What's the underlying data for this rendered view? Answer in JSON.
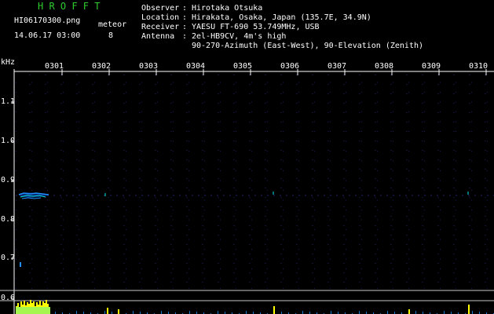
{
  "header": {
    "brand": "H R O F F T",
    "filename": "HI06170300.png",
    "datetime": "14.06.17 03:00",
    "meteor_label": "meteor",
    "meteor_count": "8"
  },
  "meta": [
    {
      "key": "Observer",
      "value": "Hirotaka Otsuka"
    },
    {
      "key": "Location",
      "value": "Hirakata, Osaka, Japan (135.7E, 34.9N)"
    },
    {
      "key": "Receiver",
      "value": "YAESU FT-690 53.749MHz, USB"
    },
    {
      "key": "Antenna",
      "value": "2el-HB9CV, 4m's high"
    }
  ],
  "antenna_line2": "90-270-Azimuth (East-West), 90-Elevation (Zenith)",
  "axis": {
    "unit": "kHz",
    "y_ticks": [
      "1.1",
      "1.0",
      "0.9",
      "0.8",
      "0.7",
      "0.6"
    ],
    "x_ticks": [
      "0301",
      "0302",
      "0303",
      "0304",
      "0305",
      "0306",
      "0307",
      "0308",
      "0309",
      "0310"
    ]
  },
  "colors": {
    "background": "#000000",
    "grid_dots": "#24246a",
    "brand": "#2ecc2e",
    "text": "#ffffff",
    "echo_primary": "#1e90ff",
    "echo_secondary": "#00e5e5",
    "histogram": "#ffff00",
    "baseline": "#c8c8c8"
  }
}
